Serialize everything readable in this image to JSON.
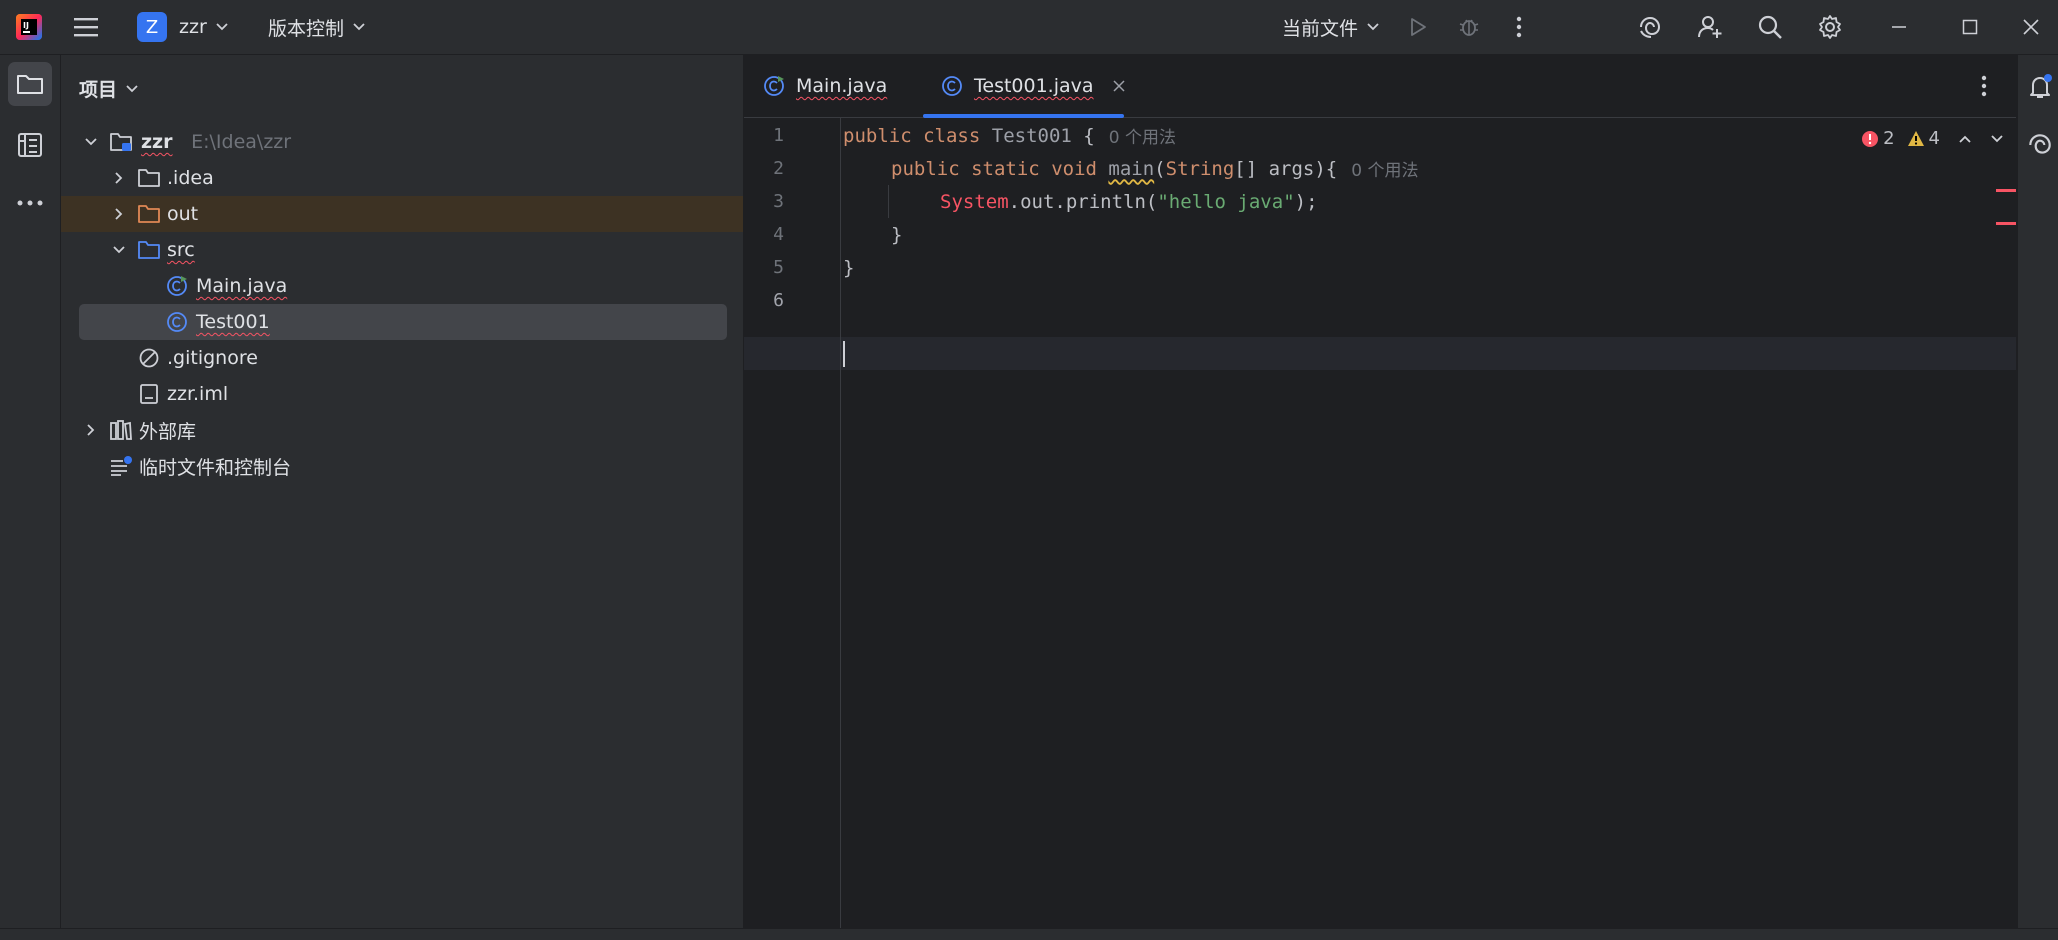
{
  "titlebar": {
    "project_badge": "Z",
    "project_name": "zzr",
    "vcs_menu": "版本控制",
    "run_config": "当前文件"
  },
  "toolstrip": {
    "icons": [
      "folder-icon",
      "structure-icon",
      "more-icon"
    ]
  },
  "project_panel": {
    "title": "项目",
    "tree": [
      {
        "label": "zzr",
        "path": "E:\\Idea\\zzr"
      },
      {
        "label": ".idea"
      },
      {
        "label": "out"
      },
      {
        "label": "src"
      },
      {
        "label": "Main.java"
      },
      {
        "label": "Test001"
      },
      {
        "label": ".gitignore"
      },
      {
        "label": "zzr.iml"
      },
      {
        "label": "外部库"
      },
      {
        "label": "临时文件和控制台"
      }
    ]
  },
  "editor": {
    "tabs": [
      {
        "label": "Main.java",
        "active": false
      },
      {
        "label": "Test001.java",
        "active": true
      }
    ],
    "inspections": {
      "errors": "2",
      "warnings": "4"
    },
    "line_numbers": [
      "1",
      "2",
      "3",
      "4",
      "5",
      "6"
    ],
    "code": {
      "l1_public": "public",
      "l1_class": "class",
      "l1_name": "Test001",
      "l1_brace": "{",
      "l1_hint": "0 个用法",
      "l2_public": "public",
      "l2_static": "static",
      "l2_void": "void",
      "l2_main": "main",
      "l2_paren": "(",
      "l2_string": "String",
      "l2_args": "[] args){",
      "l2_hint": "0 个用法",
      "l3_system": "System",
      "l3_rest": ".out.println(",
      "l3_str": "\"hello java\"",
      "l3_end": ");",
      "l4": "}",
      "l5": "}"
    }
  },
  "colors": {
    "accent": "#3574f0",
    "error": "#f75464",
    "warning": "#e0b744"
  }
}
